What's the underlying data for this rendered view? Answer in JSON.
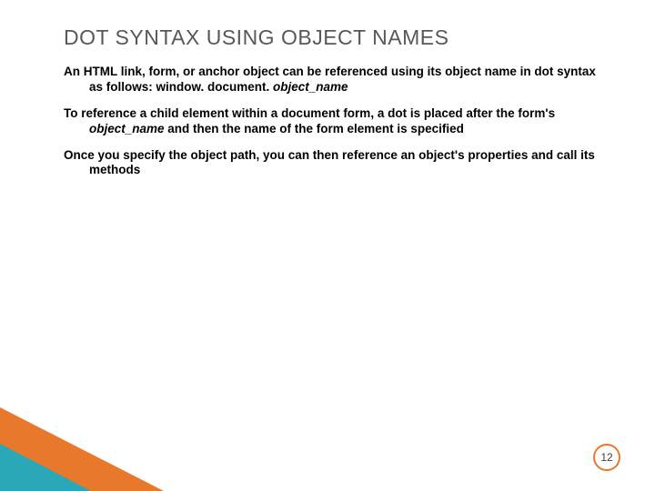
{
  "title": "DOT SYNTAX USING OBJECT NAMES",
  "para1_a": "An HTML link, form, or anchor object can be referenced using its object name in dot syntax as follows: window. document. ",
  "para1_b": "object_name",
  "para2_a": "To reference a child element within a document form, a dot is placed after the form's ",
  "para2_b": "object_name",
  "para2_c": " and then the name of the form element is specified",
  "para3": "Once you specify the object path, you can then reference an object's properties and call its methods",
  "page_number": "12"
}
